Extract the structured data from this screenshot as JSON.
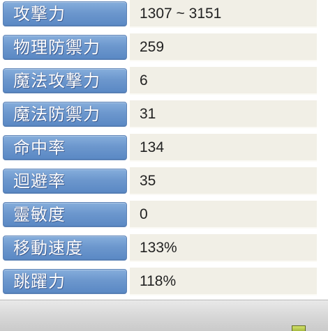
{
  "stats": [
    {
      "label": "攻撃力",
      "value": "1307 ~ 3151"
    },
    {
      "label": "物理防禦力",
      "value": "259"
    },
    {
      "label": "魔法攻撃力",
      "value": "6"
    },
    {
      "label": "魔法防禦力",
      "value": "31"
    },
    {
      "label": "命中率",
      "value": "134"
    },
    {
      "label": "迴避率",
      "value": "35"
    },
    {
      "label": "靈敏度",
      "value": "0"
    },
    {
      "label": "移動速度",
      "value": "133%"
    },
    {
      "label": "跳躍力",
      "value": "118%"
    }
  ],
  "colors": {
    "label_background": "#6c97cd",
    "label_text": "#ffffff",
    "value_background": "#f1efe6",
    "value_text": "#222222"
  }
}
